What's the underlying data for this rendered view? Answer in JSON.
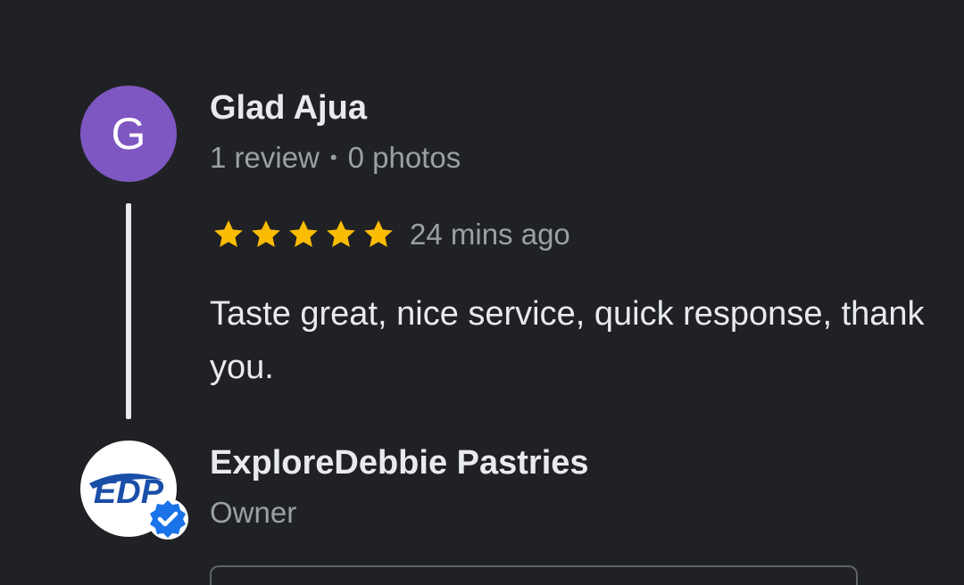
{
  "reviewer": {
    "initial": "G",
    "name": "Glad Ajua",
    "review_count": "1 review",
    "separator": "•",
    "photo_count": "0 photos",
    "avatar_color": "#7e57c2"
  },
  "review": {
    "rating": 5,
    "max_rating": 5,
    "star_color": "#fbbc04",
    "time": "24 mins ago",
    "text": "Taste great, nice service, quick response, thank you."
  },
  "owner_reply": {
    "name": "ExploreDebbie Pastries",
    "role": "Owner",
    "logo_text": "EDP",
    "verified_color": "#1a73e8",
    "logo_color": "#1a4fa8"
  }
}
